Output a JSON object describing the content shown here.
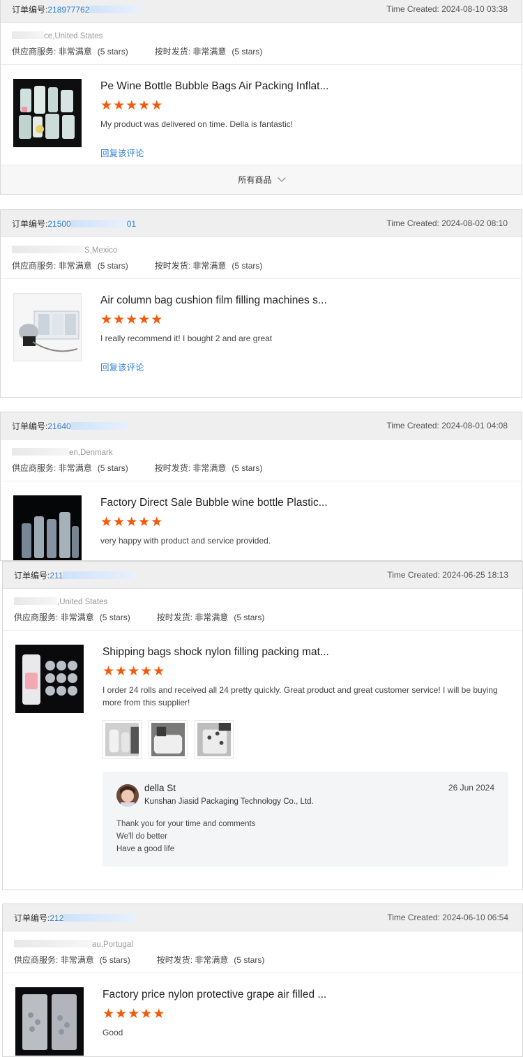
{
  "colors": {
    "accent_link": "#2f7fd6",
    "star": "#f25a0a",
    "header_bg": "#efefef"
  },
  "common": {
    "order_label": "订单编号:",
    "time_label": "Time Created:",
    "supplier_service_label": "供应商服务:",
    "on_time_label": "按时发货:",
    "rating_value": "非常满意",
    "stars_note": "(5 stars)",
    "reply_label": "回复该评论",
    "all_products_label": "所有商品",
    "star_glyph": "★"
  },
  "reviews": [
    {
      "order_prefix": "218977762",
      "order_suffix": "",
      "time": "2024-08-10 03:38",
      "location_visible": "ce,United States",
      "product_title": "Pe Wine Bottle Bubble Bags Air Packing Inflat...",
      "rating": 5,
      "text": "My product was delivered on time. Della is fantastic!"
    },
    {
      "order_prefix": "21500",
      "order_suffix": "01",
      "time": "2024-08-02 08:10",
      "location_visible": "S,Mexico",
      "product_title": "Air column bag cushion film filling machines s...",
      "rating": 5,
      "text": "I really recommend it! I bought 2 and are great"
    },
    {
      "order_prefix": "21640",
      "order_suffix": "",
      "time": "2024-08-01 04:08",
      "location_visible": "en,Denmark",
      "product_title": "Factory Direct Sale Bubble wine bottle Plastic...",
      "rating": 5,
      "text": "very happy with product and service provided."
    },
    {
      "order_prefix": "211",
      "order_suffix": "",
      "time": "2024-06-25 18:13",
      "location_visible": ",United States",
      "product_title": "Shipping bags shock nylon filling packing mat...",
      "rating": 5,
      "text": "I order 24 rolls and received all 24 pretty quickly. Great product and great customer service! I will be buying more from this supplier!",
      "seller_reply": {
        "name": "della St",
        "company": "Kunshan Jiasid Packaging Technology Co., Ltd.",
        "date": "26 Jun 2024",
        "line1": "Thank you for your time and comments",
        "line2": "We'll do better",
        "line3": "Have a good life"
      }
    },
    {
      "order_prefix": "212",
      "order_suffix": "",
      "time": "2024-06-10 06:54",
      "location_visible": "au,Portugal",
      "product_title": "Factory price nylon protective grape air filled ...",
      "rating": 5,
      "text": "Good"
    }
  ]
}
